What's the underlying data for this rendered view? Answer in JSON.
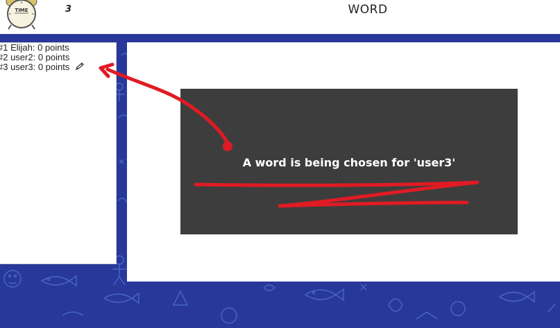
{
  "header": {
    "round_number": "3",
    "word": "WORD",
    "clock_label": "TIME"
  },
  "players": [
    {
      "label": "#1 Elijah: 0 points"
    },
    {
      "label": "#2 user2: 0 points"
    },
    {
      "label": "#3 user3: 0 points",
      "drawing": true
    }
  ],
  "overlay": {
    "message": "A word is being chosen for 'user3'"
  },
  "icons": {
    "drawing_indicator": "pencil-icon",
    "timer": "alarm-clock-icon"
  },
  "colors": {
    "background": "#28389a",
    "overlay": "#3d3d3d",
    "annotation": "#e01b24"
  }
}
